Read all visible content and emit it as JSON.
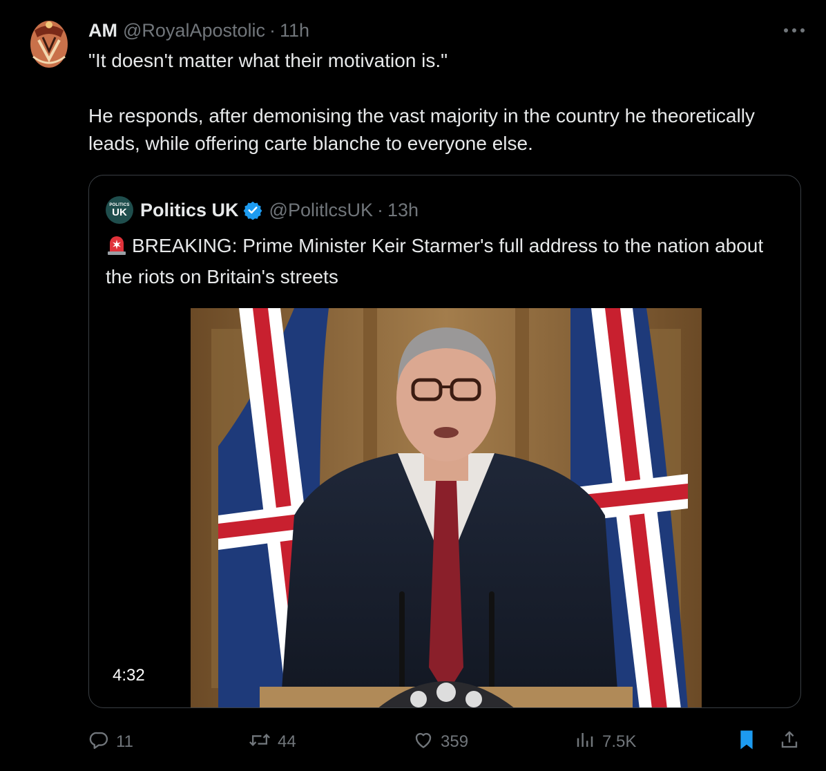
{
  "tweet": {
    "author_name": "AM",
    "author_handle": "@RoyalApostolic",
    "separator": "·",
    "time": "11h",
    "text_line1": "\"It doesn't matter what their motivation is.\"",
    "text_line2": "He responds, after demonising the vast majority in the country he theoretically leads, while offering carte blanche to everyone else."
  },
  "quote": {
    "author_name": "Politics UK",
    "avatar_small": "POLITICS",
    "avatar_big": "UK",
    "author_handle": "@PolitlcsUK",
    "separator": "·",
    "time": "13h",
    "text": "BREAKING: Prime Minister Keir Starmer's full address to the nation about the riots on Britain's streets",
    "video_duration": "4:32"
  },
  "actions": {
    "replies": "11",
    "reposts": "44",
    "likes": "359",
    "views": "7.5K"
  },
  "colors": {
    "background": "#000000",
    "text": "#e7e9ea",
    "muted": "#71767b",
    "accent": "#1d9bf0",
    "border": "#3a3f44"
  },
  "icons": [
    "more-icon",
    "verified-badge-icon",
    "siren-icon",
    "reply-icon",
    "retweet-icon",
    "like-icon",
    "views-icon",
    "bookmark-icon",
    "share-icon"
  ]
}
